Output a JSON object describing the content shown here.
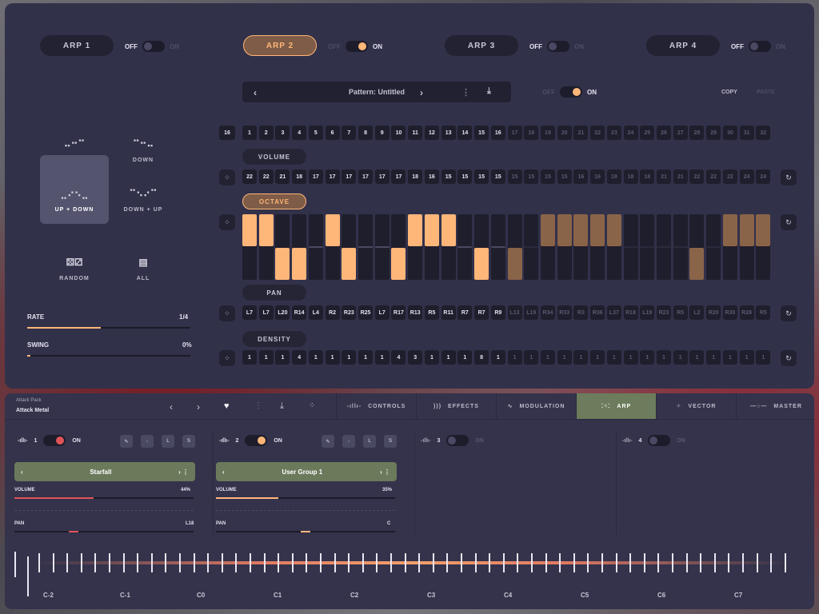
{
  "arp_tabs": [
    {
      "label": "ARP 1",
      "active": false,
      "toggle_on": false
    },
    {
      "label": "ARP 2",
      "active": true,
      "toggle_on": true
    },
    {
      "label": "ARP 3",
      "active": false,
      "toggle_on": false
    },
    {
      "label": "ARP 4",
      "active": false,
      "toggle_on": false
    }
  ],
  "toggle_text": {
    "off": "OFF",
    "on": "ON"
  },
  "pattern": {
    "name": "Pattern: Untitled",
    "prev": "‹",
    "next": "›",
    "more": "⋮",
    "download": "⤓",
    "toggle_on": true,
    "copy": "COPY",
    "paste": "PASTE"
  },
  "modes": [
    {
      "label": "UP",
      "icon": "up-icon",
      "glyph": "⠤⠒⠉"
    },
    {
      "label": "DOWN",
      "icon": "down-icon",
      "glyph": "⠉⠒⠤"
    },
    {
      "label": "UP + DOWN",
      "icon": "up-down-icon",
      "glyph": "⣀⠔⠢⣀",
      "active": true
    },
    {
      "label": "DOWN + UP",
      "icon": "down-up-icon",
      "glyph": "⠉⠢⠔⠉"
    },
    {
      "label": "RANDOM",
      "icon": "dice-icon",
      "glyph": "⚄⚂"
    },
    {
      "label": "ALL",
      "icon": "keyboard-icon",
      "glyph": "▤"
    }
  ],
  "rate": {
    "label": "RATE",
    "value": "1/4",
    "fill": 0.45
  },
  "swing": {
    "label": "SWING",
    "value": "0%",
    "fill": 0.02
  },
  "length": "16",
  "steps": [
    "1",
    "2",
    "3",
    "4",
    "5",
    "6",
    "7",
    "8",
    "9",
    "10",
    "11",
    "12",
    "13",
    "14",
    "15",
    "16",
    "17",
    "18",
    "19",
    "20",
    "21",
    "22",
    "23",
    "24",
    "25",
    "26",
    "27",
    "28",
    "29",
    "30",
    "31",
    "32"
  ],
  "active_steps": 16,
  "lanes": {
    "volume": "VOLUME",
    "octave": "OCTAVE",
    "pan": "PAN",
    "density": "DENSITY"
  },
  "volume_values": [
    "22",
    "22",
    "21",
    "18",
    "17",
    "17",
    "17",
    "17",
    "17",
    "17",
    "18",
    "16",
    "15",
    "15",
    "15",
    "15",
    "15",
    "15",
    "15",
    "15",
    "16",
    "16",
    "18",
    "18",
    "18",
    "21",
    "21",
    "22",
    "22",
    "22",
    "24",
    "24"
  ],
  "octave_values": [
    1,
    1,
    -1,
    -1,
    0,
    1,
    -1,
    0,
    0,
    -1,
    1,
    1,
    1,
    0,
    -1,
    0,
    -1,
    0,
    1,
    1,
    1,
    1,
    1,
    0,
    0,
    0,
    0,
    -1,
    0,
    1,
    1,
    1
  ],
  "pan_values": [
    "L7",
    "L7",
    "L20",
    "R14",
    "L4",
    "R2",
    "R23",
    "R25",
    "L7",
    "R17",
    "R13",
    "R5",
    "R11",
    "R7",
    "R7",
    "R9",
    "L13",
    "L19",
    "R34",
    "R33",
    "R3",
    "R36",
    "L37",
    "R18",
    "L19",
    "R23",
    "R5",
    "L2",
    "R20",
    "R30",
    "R28",
    "R5"
  ],
  "density_values": [
    "1",
    "1",
    "1",
    "4",
    "1",
    "1",
    "1",
    "1",
    "1",
    "4",
    "3",
    "1",
    "1",
    "1",
    "8",
    "1",
    "1",
    "1",
    "1",
    "1",
    "1",
    "1",
    "1",
    "1",
    "1",
    "1",
    "1",
    "1",
    "1",
    "1",
    "1",
    "1"
  ],
  "colors": {
    "accent": "#ffb679",
    "accent_dim": "#8a6448",
    "panel": "#32314a",
    "cell": "#1f1e2c",
    "green": "#6c7a5c"
  },
  "preset": {
    "bank": "Attack Pack",
    "name": "Attack Metal"
  },
  "nav_tabs": [
    {
      "label": "CONTROLS",
      "icon": "waveform-icon",
      "glyph": "-ıllı-"
    },
    {
      "label": "EFFECTS",
      "icon": "effects-icon",
      "glyph": ")))"
    },
    {
      "label": "MODULATION",
      "icon": "modulation-icon",
      "glyph": "∿"
    },
    {
      "label": "ARP",
      "icon": "arp-icon",
      "glyph": "⁚⁖⁚",
      "active": true
    },
    {
      "label": "VECTOR",
      "icon": "vector-icon",
      "glyph": "⁘"
    },
    {
      "label": "MASTER",
      "icon": "master-icon",
      "glyph": "—○—"
    }
  ],
  "layers": [
    {
      "num": "1",
      "on": true,
      "color": "#e05458",
      "preset": "Starfall",
      "volume": "44%",
      "vol_fill": 0.44,
      "pan": "L18",
      "pan_pos": 0.33,
      "btns": [
        "✎",
        "⁖",
        "L",
        "S"
      ]
    },
    {
      "num": "2",
      "on": true,
      "color": "#ffb679",
      "preset": "User Group 1",
      "volume": "35%",
      "vol_fill": 0.35,
      "pan": "C",
      "pan_pos": 0.5,
      "btns": [
        "✎",
        "⁖",
        "L",
        "S"
      ]
    },
    {
      "num": "3",
      "on": false
    },
    {
      "num": "4",
      "on": false
    }
  ],
  "layer_labels": {
    "volume": "VOLUME",
    "pan": "PAN"
  },
  "octaves": [
    "C-2",
    "C-1",
    "C0",
    "C1",
    "C2",
    "C3",
    "C4",
    "C5",
    "C6",
    "C7"
  ]
}
